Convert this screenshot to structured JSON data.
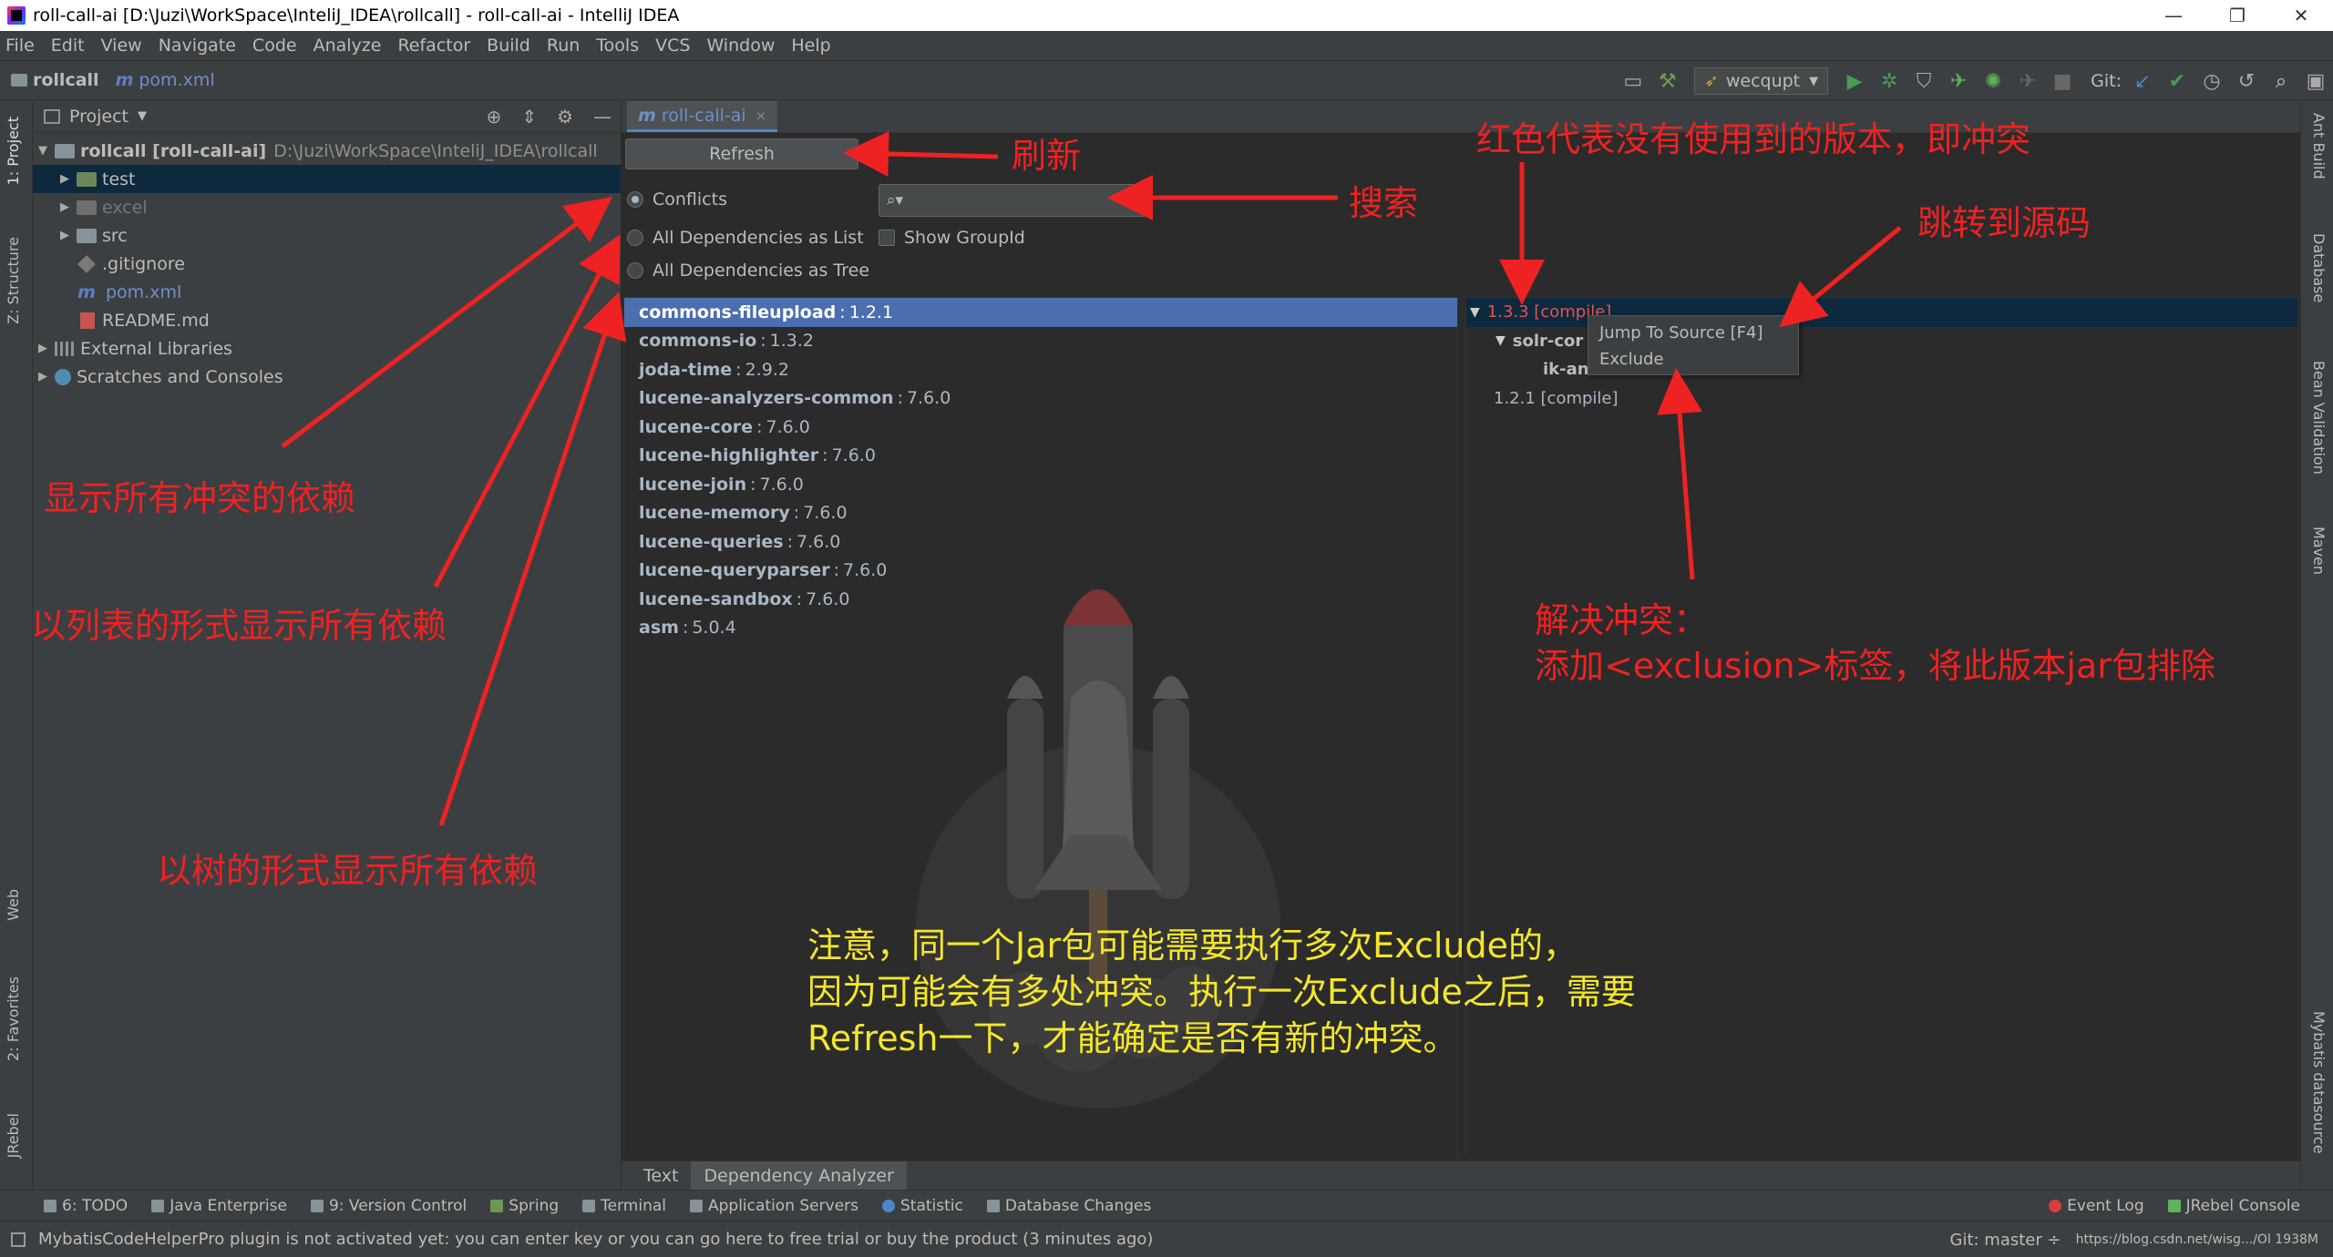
{
  "window": {
    "title": "roll-call-ai [D:\\Juzi\\WorkSpace\\InteliJ_IDEA\\rollcall] - roll-call-ai - IntelliJ IDEA",
    "minimize": "—",
    "maximize": "❐",
    "close": "✕"
  },
  "menu": [
    "File",
    "Edit",
    "View",
    "Navigate",
    "Code",
    "Analyze",
    "Refactor",
    "Build",
    "Run",
    "Tools",
    "VCS",
    "Window",
    "Help"
  ],
  "navbar": {
    "project": "rollcall",
    "file": "pom.xml",
    "run_config": "wecqupt",
    "git_label": "Git:"
  },
  "project_panel": {
    "title": "Project",
    "tree": [
      {
        "label": "rollcall [roll-call-ai]",
        "path": "D:\\Juzi\\WorkSpace\\InteliJ_IDEA\\rollcall"
      },
      {
        "label": "test"
      },
      {
        "label": "excel"
      },
      {
        "label": "src"
      },
      {
        "label": ".gitignore"
      },
      {
        "label": "pom.xml"
      },
      {
        "label": "README.md"
      },
      {
        "label": "External Libraries"
      },
      {
        "label": "Scratches and Consoles"
      }
    ]
  },
  "left_tabs": {
    "project": "1: Project",
    "structure": "Z: Structure",
    "web": "Web",
    "favorites": "2: Favorites",
    "jrebel": "JRebel"
  },
  "right_tabs": {
    "ant": "Ant Build",
    "database": "Database",
    "bean": "Bean Validation",
    "maven": "Maven",
    "mybatis": "Mybatis datasource"
  },
  "editor": {
    "tab_label": "roll-call-ai",
    "tab_close": "×",
    "refresh": "Refresh",
    "radio_conflicts": "Conflicts",
    "radio_list": "All Dependencies as List",
    "radio_tree": "All Dependencies as Tree",
    "search_icon": "🔍",
    "show_groupid": "Show GroupId",
    "dependencies": [
      {
        "name": "commons-fileupload",
        "version": "1.2.1"
      },
      {
        "name": "commons-io",
        "version": "1.3.2"
      },
      {
        "name": "joda-time",
        "version": "2.9.2"
      },
      {
        "name": "lucene-analyzers-common",
        "version": "7.6.0"
      },
      {
        "name": "lucene-core",
        "version": "7.6.0"
      },
      {
        "name": "lucene-highlighter",
        "version": "7.6.0"
      },
      {
        "name": "lucene-join",
        "version": "7.6.0"
      },
      {
        "name": "lucene-memory",
        "version": "7.6.0"
      },
      {
        "name": "lucene-queries",
        "version": "7.6.0"
      },
      {
        "name": "lucene-queryparser",
        "version": "7.6.0"
      },
      {
        "name": "lucene-sandbox",
        "version": "7.6.0"
      },
      {
        "name": "asm",
        "version": "5.0.4"
      }
    ],
    "dep_separator": ":",
    "tree": {
      "root": "1.3.3 [compile]",
      "child": "solr-cor",
      "grandchild": "ik-an",
      "second": "1.2.1 [compile]"
    },
    "context_menu": [
      "Jump To Source [F4]",
      "Exclude"
    ],
    "bottom_tabs": [
      "Text",
      "Dependency Analyzer"
    ]
  },
  "tool_windows": {
    "left": [
      "6: TODO",
      "Java Enterprise",
      "9: Version Control",
      "Spring",
      "Terminal",
      "Application Servers",
      "Statistic",
      "Database Changes"
    ],
    "right": [
      "Event Log",
      "JRebel Console"
    ]
  },
  "status": {
    "message": "MybatisCodeHelperPro plugin is not activated yet: you can enter key or you can go here to free trial or buy the product (3 minutes ago)",
    "git": "Git: master ÷",
    "watermark": "https://blog.csdn.net/wisg.../Ol 1938M"
  },
  "annotations": {
    "refresh": "刷新",
    "search": "搜索",
    "red_version": "红色代表没有使用到的版本，即冲突",
    "jump_source": "跳转到源码",
    "show_conflicts": "显示所有冲突的依赖",
    "show_list": "以列表的形式显示所有依赖",
    "show_tree": "以树的形式显示所有依赖",
    "resolve_1": "解决冲突：",
    "resolve_2": "添加<exclusion>标签，将此版本jar包排除",
    "note_1": "注意，同一个Jar包可能需要执行多次Exclude的，",
    "note_2": "因为可能会有多处冲突。执行一次Exclude之后，需要",
    "note_3": "Refresh一下，才能确定是否有新的冲突。"
  },
  "colors": {
    "annotation_red": "#ee2222",
    "annotation_yellow": "#f4e62a",
    "selection": "#4b6eaf",
    "conflict_red": "#e2554f"
  }
}
